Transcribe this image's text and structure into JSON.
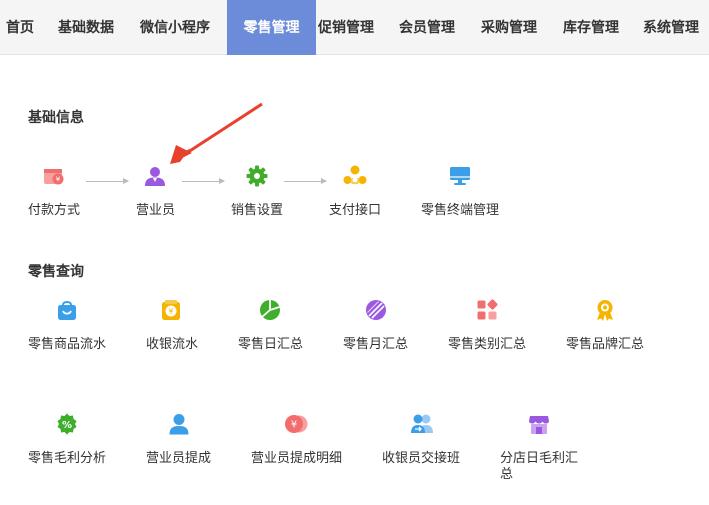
{
  "nav": {
    "items": [
      {
        "label": "首页"
      },
      {
        "label": "基础数据"
      },
      {
        "label": "微信小程序"
      },
      {
        "label": "零售管理"
      },
      {
        "label": "促销管理"
      },
      {
        "label": "会员管理"
      },
      {
        "label": "采购管理"
      },
      {
        "label": "库存管理"
      },
      {
        "label": "系统管理"
      }
    ],
    "active": "零售管理"
  },
  "basic": {
    "title": "基础信息",
    "items": [
      {
        "label": "付款方式",
        "icon": "payment-card-icon",
        "color": "#f26d6d"
      },
      {
        "label": "营业员",
        "icon": "salesperson-icon",
        "color": "#9b59e0"
      },
      {
        "label": "销售设置",
        "icon": "gear-icon",
        "color": "#3fae2a"
      },
      {
        "label": "支付接口",
        "icon": "payment-interface-icon",
        "color": "#f5b400"
      },
      {
        "label": "零售终端管理",
        "icon": "monitor-icon",
        "color": "#3a9ee8"
      }
    ]
  },
  "query": {
    "title": "零售查询",
    "row1": [
      {
        "label": "零售商品流水",
        "icon": "shopping-bag-icon",
        "color": "#3a9ee8"
      },
      {
        "label": "收银流水",
        "icon": "cash-register-icon",
        "color": "#f5b400"
      },
      {
        "label": "零售日汇总",
        "icon": "daily-summary-icon",
        "color": "#3fae2a"
      },
      {
        "label": "零售月汇总",
        "icon": "monthly-summary-icon",
        "color": "#9b59e0"
      },
      {
        "label": "零售类别汇总",
        "icon": "category-grid-icon",
        "color": "#f26d6d"
      },
      {
        "label": "零售品牌汇总",
        "icon": "brand-badge-icon",
        "color": "#f5b400"
      }
    ],
    "row2": [
      {
        "label": "零售毛利分析",
        "icon": "percent-icon",
        "color": "#3fae2a"
      },
      {
        "label": "营业员提成",
        "icon": "person-icon",
        "color": "#3a9ee8"
      },
      {
        "label": "营业员提成明细",
        "icon": "commission-detail-icon",
        "color": "#f26d6d"
      },
      {
        "label": "收银员交接班",
        "icon": "shift-handover-icon",
        "color": "#3a9ee8"
      },
      {
        "label": "分店日毛利汇总",
        "icon": "branch-store-icon",
        "color": "#9b59e0"
      }
    ]
  },
  "annotation": {
    "color": "#e8412f"
  }
}
